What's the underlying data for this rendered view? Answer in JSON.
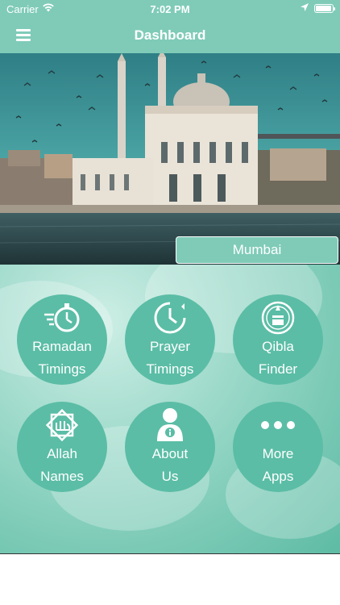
{
  "status_bar": {
    "carrier": "Carrier",
    "time": "7:02 PM",
    "battery_level": 0.95
  },
  "header": {
    "title": "Dashboard",
    "menu_icon": "hamburger-menu-icon"
  },
  "hero": {
    "city": "Mumbai"
  },
  "tiles": [
    {
      "line1": "Ramadan",
      "line2": "Timings",
      "icon": "stopwatch-icon"
    },
    {
      "line1": "Prayer",
      "line2": "Timings",
      "icon": "clock-icon"
    },
    {
      "line1": "Qibla",
      "line2": "Finder",
      "icon": "compass-kaaba-icon"
    },
    {
      "line1": "Allah",
      "line2": "Names",
      "icon": "calligraphy-star-icon"
    },
    {
      "line1": "About",
      "line2": "Us",
      "icon": "person-info-icon"
    },
    {
      "line1": "More",
      "line2": "Apps",
      "icon": "dots-icon"
    }
  ],
  "colors": {
    "header": "#7fcbb8",
    "tile": "#5bbda6",
    "text": "#ffffff"
  }
}
